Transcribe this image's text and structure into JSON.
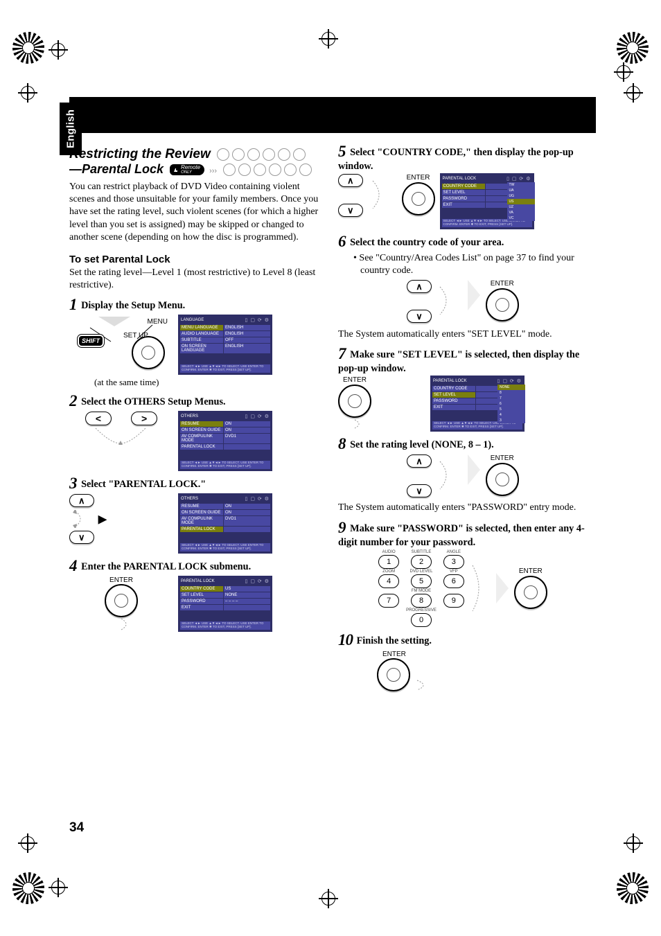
{
  "sidetab": "English",
  "header": {
    "title": "Restricting the Review",
    "subtitle_prefix": "—Parental Lock",
    "remote_badge": {
      "line1": "Remote",
      "line2": "ONLY"
    }
  },
  "intro": "You can restrict playback of DVD Video containing violent scenes and those unsuitable for your family members. Once you have set the rating level, such violent scenes (for which a higher level than you set is assigned) may be skipped or changed to another scene (depending on how the disc is programmed).",
  "subhead1": "To set Parental Lock",
  "subhead1_body": "Set the rating level—Level 1 (most restrictive) to Level 8 (least restrictive).",
  "steps": {
    "s1": "Display the Setup Menu.",
    "s1_labels": {
      "menu": "MENU",
      "setup": "SET UP",
      "shift": "SHIFT",
      "caption": "(at the same time)"
    },
    "s2": "Select the OTHERS Setup Menus.",
    "s3": "Select \"PARENTAL LOCK.\"",
    "s4": "Enter the PARENTAL LOCK submenu.",
    "s5": "Select \"COUNTRY CODE,\" then display the pop-up window.",
    "s6": "Select the country code of your area.",
    "s6_note": "• See \"Country/Area Codes List\" on page 37  to find your country code.",
    "s6_after": "The System automatically enters \"SET  LEVEL\" mode.",
    "s7": "Make sure \"SET LEVEL\" is selected, then display the pop-up window.",
    "s8": "Set the rating level (NONE, 8 – 1).",
    "s8_after": "The System automatically enters \"PASSWORD\" entry mode.",
    "s9": "Make sure \"PASSWORD\" is selected, then enter any 4-digit number for your password.",
    "s10": "Finish the setting."
  },
  "enter_label": "ENTER",
  "panels": {
    "language": {
      "title": "LANGUAGE",
      "rows": [
        [
          "MENU LANGUAGE",
          "ENGLISH"
        ],
        [
          "AUDIO LANGUAGE",
          "ENGLISH"
        ],
        [
          "SUBTITLE",
          "OFF"
        ],
        [
          "ON SCREEN LANGUAGE",
          "ENGLISH"
        ]
      ]
    },
    "others": {
      "title": "OTHERS",
      "rows": [
        [
          "RESUME",
          "ON"
        ],
        [
          "ON SCREEN GUIDE",
          "ON"
        ],
        [
          "AV COMPULINK MODE",
          "DVD1"
        ],
        [
          "PARENTAL LOCK",
          ""
        ]
      ]
    },
    "parental": {
      "title": "PARENTAL LOCK",
      "rows": [
        [
          "COUNTRY CODE",
          "US"
        ],
        [
          "SET LEVEL",
          "NONE"
        ],
        [
          "PASSWORD",
          "– – – –"
        ],
        [
          "EXIT",
          ""
        ]
      ]
    },
    "parental_cc_pop": {
      "items": [
        "TW",
        "UA",
        "UG",
        "US",
        "UZ",
        "VA",
        "VC"
      ]
    },
    "parental_level_pop": {
      "header": "NONE",
      "items": [
        "8",
        "7",
        "6",
        "5",
        "4",
        "3"
      ]
    },
    "foot": "SELECT ◄►   USE ▲▼◄► TO SELECT.  USE ENTER TO CONFIRM.\nENTER ✱    TO EXIT, PRESS [SET UP]."
  },
  "numpad": {
    "labels": [
      "AUDIO",
      "SUBTITLE",
      "ANGLE",
      "ZOOM",
      "DVD LEVEL",
      "VFP",
      "",
      "FM MODE",
      "",
      "",
      "PROGRESSIVE",
      ""
    ],
    "nums": [
      "1",
      "2",
      "3",
      "4",
      "5",
      "6",
      "7",
      "8",
      "9",
      "0"
    ]
  },
  "page_number": "34"
}
